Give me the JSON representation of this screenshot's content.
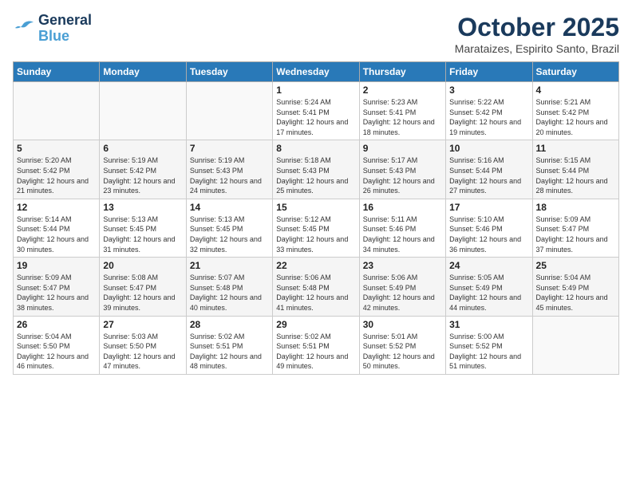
{
  "header": {
    "logo_line1": "General",
    "logo_line2": "Blue",
    "month": "October 2025",
    "location": "Marataizes, Espirito Santo, Brazil"
  },
  "weekdays": [
    "Sunday",
    "Monday",
    "Tuesday",
    "Wednesday",
    "Thursday",
    "Friday",
    "Saturday"
  ],
  "weeks": [
    [
      {
        "day": "",
        "content": ""
      },
      {
        "day": "",
        "content": ""
      },
      {
        "day": "",
        "content": ""
      },
      {
        "day": "1",
        "content": "Sunrise: 5:24 AM\nSunset: 5:41 PM\nDaylight: 12 hours and 17 minutes."
      },
      {
        "day": "2",
        "content": "Sunrise: 5:23 AM\nSunset: 5:41 PM\nDaylight: 12 hours and 18 minutes."
      },
      {
        "day": "3",
        "content": "Sunrise: 5:22 AM\nSunset: 5:42 PM\nDaylight: 12 hours and 19 minutes."
      },
      {
        "day": "4",
        "content": "Sunrise: 5:21 AM\nSunset: 5:42 PM\nDaylight: 12 hours and 20 minutes."
      }
    ],
    [
      {
        "day": "5",
        "content": "Sunrise: 5:20 AM\nSunset: 5:42 PM\nDaylight: 12 hours and 21 minutes."
      },
      {
        "day": "6",
        "content": "Sunrise: 5:19 AM\nSunset: 5:42 PM\nDaylight: 12 hours and 23 minutes."
      },
      {
        "day": "7",
        "content": "Sunrise: 5:19 AM\nSunset: 5:43 PM\nDaylight: 12 hours and 24 minutes."
      },
      {
        "day": "8",
        "content": "Sunrise: 5:18 AM\nSunset: 5:43 PM\nDaylight: 12 hours and 25 minutes."
      },
      {
        "day": "9",
        "content": "Sunrise: 5:17 AM\nSunset: 5:43 PM\nDaylight: 12 hours and 26 minutes."
      },
      {
        "day": "10",
        "content": "Sunrise: 5:16 AM\nSunset: 5:44 PM\nDaylight: 12 hours and 27 minutes."
      },
      {
        "day": "11",
        "content": "Sunrise: 5:15 AM\nSunset: 5:44 PM\nDaylight: 12 hours and 28 minutes."
      }
    ],
    [
      {
        "day": "12",
        "content": "Sunrise: 5:14 AM\nSunset: 5:44 PM\nDaylight: 12 hours and 30 minutes."
      },
      {
        "day": "13",
        "content": "Sunrise: 5:13 AM\nSunset: 5:45 PM\nDaylight: 12 hours and 31 minutes."
      },
      {
        "day": "14",
        "content": "Sunrise: 5:13 AM\nSunset: 5:45 PM\nDaylight: 12 hours and 32 minutes."
      },
      {
        "day": "15",
        "content": "Sunrise: 5:12 AM\nSunset: 5:45 PM\nDaylight: 12 hours and 33 minutes."
      },
      {
        "day": "16",
        "content": "Sunrise: 5:11 AM\nSunset: 5:46 PM\nDaylight: 12 hours and 34 minutes."
      },
      {
        "day": "17",
        "content": "Sunrise: 5:10 AM\nSunset: 5:46 PM\nDaylight: 12 hours and 36 minutes."
      },
      {
        "day": "18",
        "content": "Sunrise: 5:09 AM\nSunset: 5:47 PM\nDaylight: 12 hours and 37 minutes."
      }
    ],
    [
      {
        "day": "19",
        "content": "Sunrise: 5:09 AM\nSunset: 5:47 PM\nDaylight: 12 hours and 38 minutes."
      },
      {
        "day": "20",
        "content": "Sunrise: 5:08 AM\nSunset: 5:47 PM\nDaylight: 12 hours and 39 minutes."
      },
      {
        "day": "21",
        "content": "Sunrise: 5:07 AM\nSunset: 5:48 PM\nDaylight: 12 hours and 40 minutes."
      },
      {
        "day": "22",
        "content": "Sunrise: 5:06 AM\nSunset: 5:48 PM\nDaylight: 12 hours and 41 minutes."
      },
      {
        "day": "23",
        "content": "Sunrise: 5:06 AM\nSunset: 5:49 PM\nDaylight: 12 hours and 42 minutes."
      },
      {
        "day": "24",
        "content": "Sunrise: 5:05 AM\nSunset: 5:49 PM\nDaylight: 12 hours and 44 minutes."
      },
      {
        "day": "25",
        "content": "Sunrise: 5:04 AM\nSunset: 5:49 PM\nDaylight: 12 hours and 45 minutes."
      }
    ],
    [
      {
        "day": "26",
        "content": "Sunrise: 5:04 AM\nSunset: 5:50 PM\nDaylight: 12 hours and 46 minutes."
      },
      {
        "day": "27",
        "content": "Sunrise: 5:03 AM\nSunset: 5:50 PM\nDaylight: 12 hours and 47 minutes."
      },
      {
        "day": "28",
        "content": "Sunrise: 5:02 AM\nSunset: 5:51 PM\nDaylight: 12 hours and 48 minutes."
      },
      {
        "day": "29",
        "content": "Sunrise: 5:02 AM\nSunset: 5:51 PM\nDaylight: 12 hours and 49 minutes."
      },
      {
        "day": "30",
        "content": "Sunrise: 5:01 AM\nSunset: 5:52 PM\nDaylight: 12 hours and 50 minutes."
      },
      {
        "day": "31",
        "content": "Sunrise: 5:00 AM\nSunset: 5:52 PM\nDaylight: 12 hours and 51 minutes."
      },
      {
        "day": "",
        "content": ""
      }
    ]
  ]
}
